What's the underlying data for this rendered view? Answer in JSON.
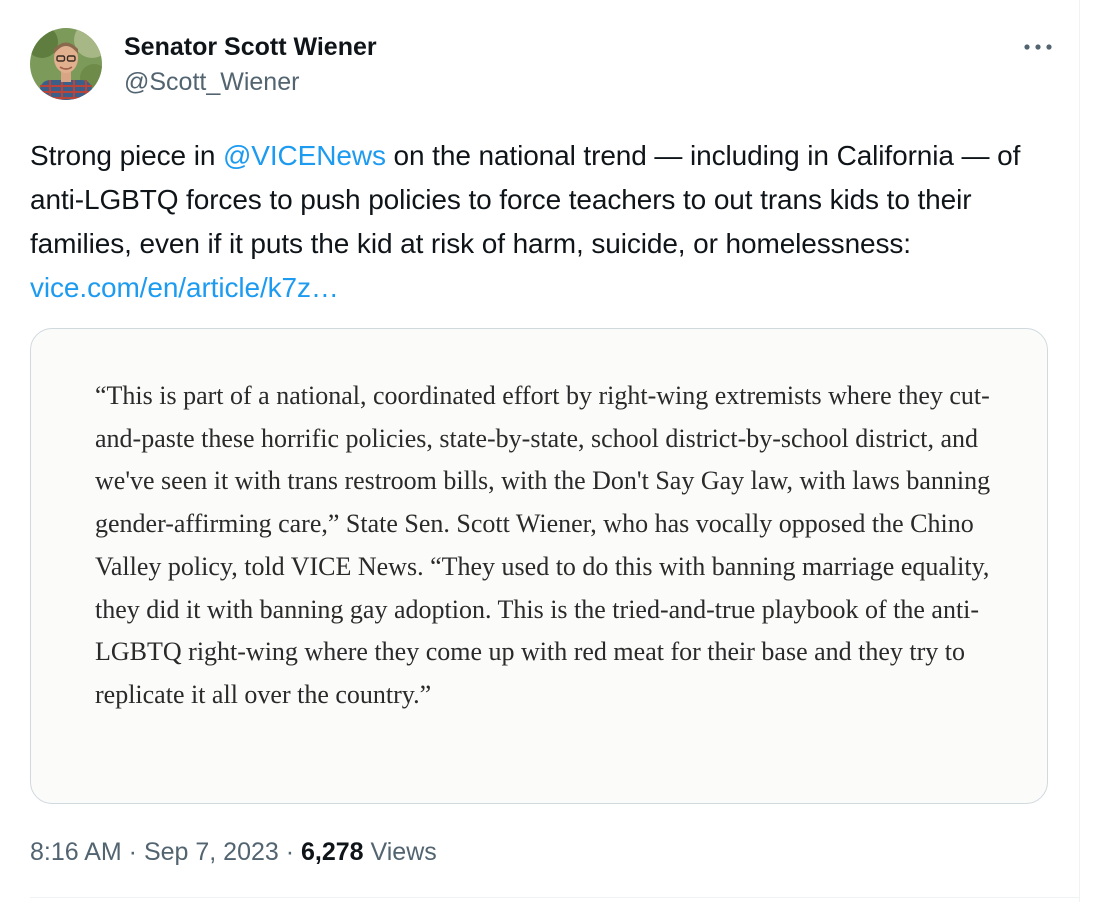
{
  "author": {
    "display_name": "Senator Scott Wiener",
    "handle": "@Scott_Wiener",
    "avatar_icon": "profile-photo-avatar"
  },
  "menu": {
    "icon": "more-horizontal-icon"
  },
  "tweet": {
    "text_before_mention": "Strong piece in ",
    "mention": "@VICENews",
    "text_after_mention": " on the national trend — including in California — of anti-LGBTQ forces to push policies to force teachers to out trans kids to their families, even if it puts the kid at risk of harm, suicide, or homelessness: ",
    "link": "vice.com/en/article/k7z…"
  },
  "media": {
    "quote": "“This is part of a national, coordinated effort by right-wing extremists where they cut-and-paste these horrific policies, state-by-state, school district-by-school district, and we've seen it with trans restroom bills, with the Don't Say Gay law, with laws banning gender-affirming care,” State Sen. Scott Wiener, who has vocally opposed the Chino Valley policy, told VICE News. “They used to do this with banning marriage equality, they did it with banning gay adoption. This is the tried-and-true playbook of the anti-LGBTQ right-wing where they come up with red meat for their base and they try to replicate it all over the country.”"
  },
  "meta": {
    "time": "8:16 AM",
    "separator": " · ",
    "date": "Sep 7, 2023",
    "views_count": "6,278",
    "views_label": " Views"
  },
  "colors": {
    "link": "#1d9bf0",
    "secondary_text": "#536471",
    "primary_text": "#0f1419",
    "border": "#cfd9de"
  }
}
